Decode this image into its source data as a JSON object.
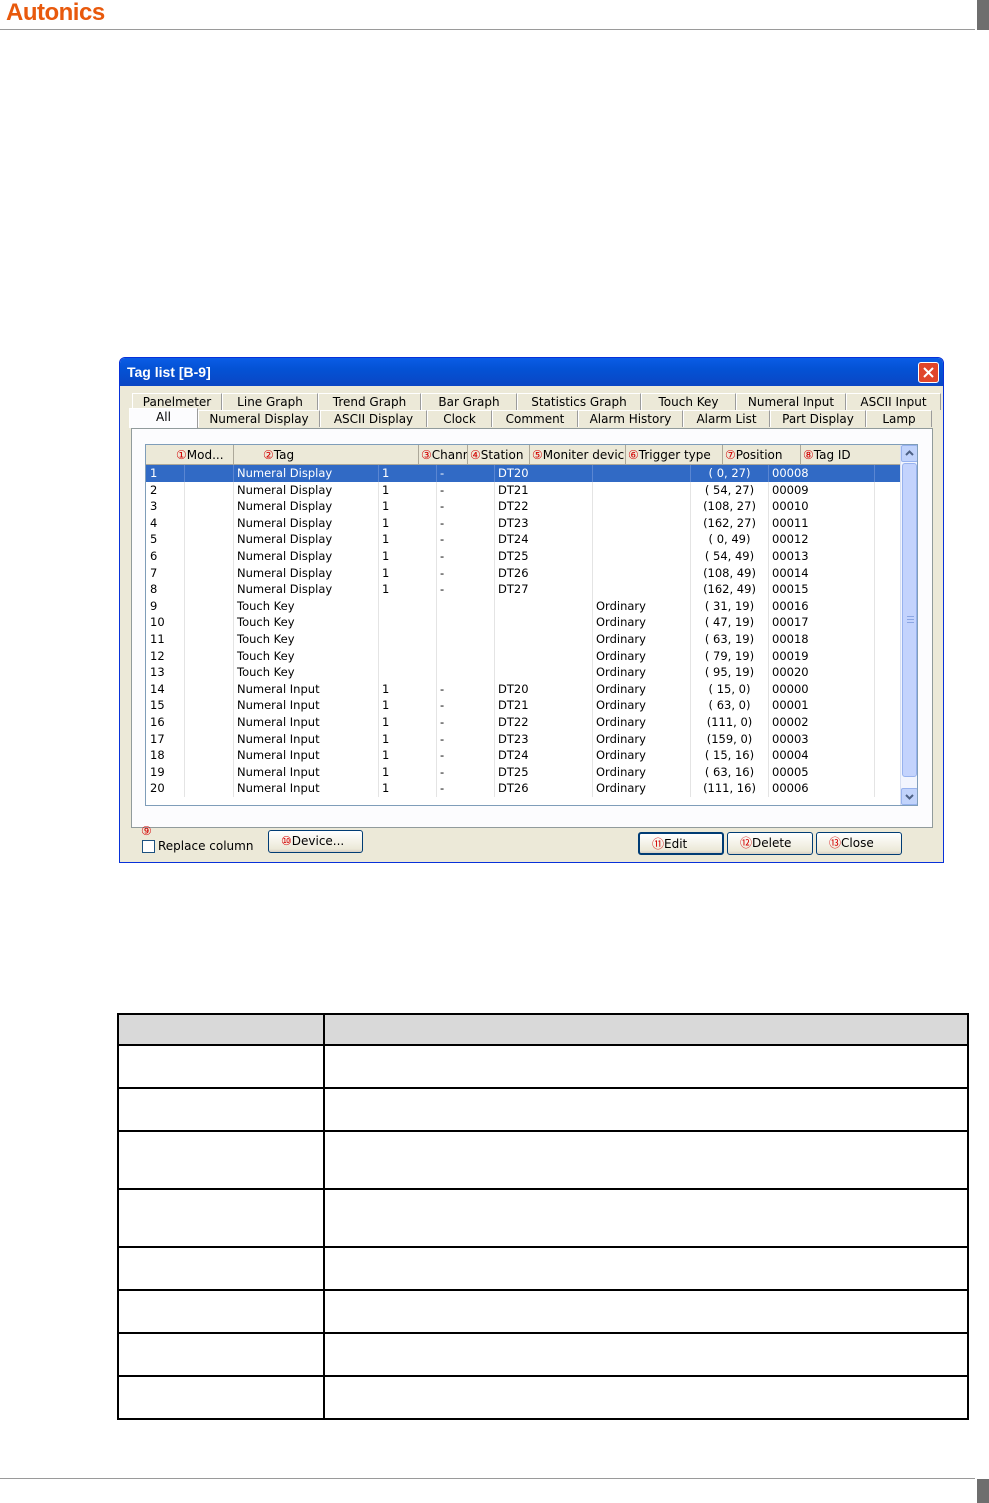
{
  "page": {
    "brand": "Autonics"
  },
  "window": {
    "title": "Tag list [B-9]"
  },
  "tabs": {
    "row1": [
      "Panelmeter",
      "Line Graph",
      "Trend Graph",
      "Bar Graph",
      "Statistics Graph",
      "Touch Key",
      "Numeral Input",
      "ASCII Input"
    ],
    "row2": [
      "All",
      "Numeral Display",
      "ASCII Display",
      "Clock",
      "Comment",
      "Alarm History",
      "Alarm List",
      "Part Display",
      "Lamp"
    ],
    "active": "All"
  },
  "list": {
    "columns": [
      {
        "marker": "①",
        "label": "Mod..."
      },
      {
        "marker": "②",
        "label": "Tag"
      },
      {
        "marker": "③",
        "label": "Channel"
      },
      {
        "marker": "④",
        "label": "Station"
      },
      {
        "marker": "⑤",
        "label": "Moniter device"
      },
      {
        "marker": "⑥",
        "label": "Trigger type"
      },
      {
        "marker": "⑦",
        "label": "Position"
      },
      {
        "marker": "⑧",
        "label": "Tag ID"
      }
    ],
    "rows": [
      [
        "1",
        "",
        "Numeral Display",
        "",
        "1",
        "-",
        "DT20",
        "",
        "( 0, 27)",
        "00008"
      ],
      [
        "2",
        "",
        "Numeral Display",
        "",
        "1",
        "-",
        "DT21",
        "",
        "( 54, 27)",
        "00009"
      ],
      [
        "3",
        "",
        "Numeral Display",
        "",
        "1",
        "-",
        "DT22",
        "",
        "(108, 27)",
        "00010"
      ],
      [
        "4",
        "",
        "Numeral Display",
        "",
        "1",
        "-",
        "DT23",
        "",
        "(162, 27)",
        "00011"
      ],
      [
        "5",
        "",
        "Numeral Display",
        "",
        "1",
        "-",
        "DT24",
        "",
        "( 0, 49)",
        "00012"
      ],
      [
        "6",
        "",
        "Numeral Display",
        "",
        "1",
        "-",
        "DT25",
        "",
        "( 54, 49)",
        "00013"
      ],
      [
        "7",
        "",
        "Numeral Display",
        "",
        "1",
        "-",
        "DT26",
        "",
        "(108, 49)",
        "00014"
      ],
      [
        "8",
        "",
        "Numeral Display",
        "",
        "1",
        "-",
        "DT27",
        "",
        "(162, 49)",
        "00015"
      ],
      [
        "9",
        "",
        "Touch Key",
        "",
        "",
        "",
        "",
        "Ordinary",
        "( 31, 19)",
        "00016"
      ],
      [
        "10",
        "",
        "Touch Key",
        "",
        "",
        "",
        "",
        "Ordinary",
        "( 47, 19)",
        "00017"
      ],
      [
        "11",
        "",
        "Touch Key",
        "",
        "",
        "",
        "",
        "Ordinary",
        "( 63, 19)",
        "00018"
      ],
      [
        "12",
        "",
        "Touch Key",
        "",
        "",
        "",
        "",
        "Ordinary",
        "( 79, 19)",
        "00019"
      ],
      [
        "13",
        "",
        "Touch Key",
        "",
        "",
        "",
        "",
        "Ordinary",
        "( 95, 19)",
        "00020"
      ],
      [
        "14",
        "",
        "Numeral Input",
        "",
        "1",
        "-",
        "DT20",
        "Ordinary",
        "( 15, 0)",
        "00000"
      ],
      [
        "15",
        "",
        "Numeral Input",
        "",
        "1",
        "-",
        "DT21",
        "Ordinary",
        "( 63, 0)",
        "00001"
      ],
      [
        "16",
        "",
        "Numeral Input",
        "",
        "1",
        "-",
        "DT22",
        "Ordinary",
        "(111, 0)",
        "00002"
      ],
      [
        "17",
        "",
        "Numeral Input",
        "",
        "1",
        "-",
        "DT23",
        "Ordinary",
        "(159, 0)",
        "00003"
      ],
      [
        "18",
        "",
        "Numeral Input",
        "",
        "1",
        "-",
        "DT24",
        "Ordinary",
        "( 15, 16)",
        "00004"
      ],
      [
        "19",
        "",
        "Numeral Input",
        "",
        "1",
        "-",
        "DT25",
        "Ordinary",
        "( 63, 16)",
        "00005"
      ],
      [
        "20",
        "",
        "Numeral Input",
        "",
        "1",
        "-",
        "DT26",
        "Ordinary",
        "(111, 16)",
        "00006"
      ]
    ],
    "selected_row": 0
  },
  "footer": {
    "replace_marker": "⑨",
    "replace_label": "Replace column",
    "device_marker": "⑩",
    "device_label": "Device...",
    "edit_marker": "⑪",
    "edit_label": "Edit",
    "delete_marker": "⑫",
    "delete_label": "Delete",
    "close_marker": "⑬",
    "close_label": "Close"
  },
  "colors": {
    "brand": "#e8590c",
    "titlebar": "#0a5ce6",
    "selection": "#316ac5",
    "marker": "#d40000"
  }
}
